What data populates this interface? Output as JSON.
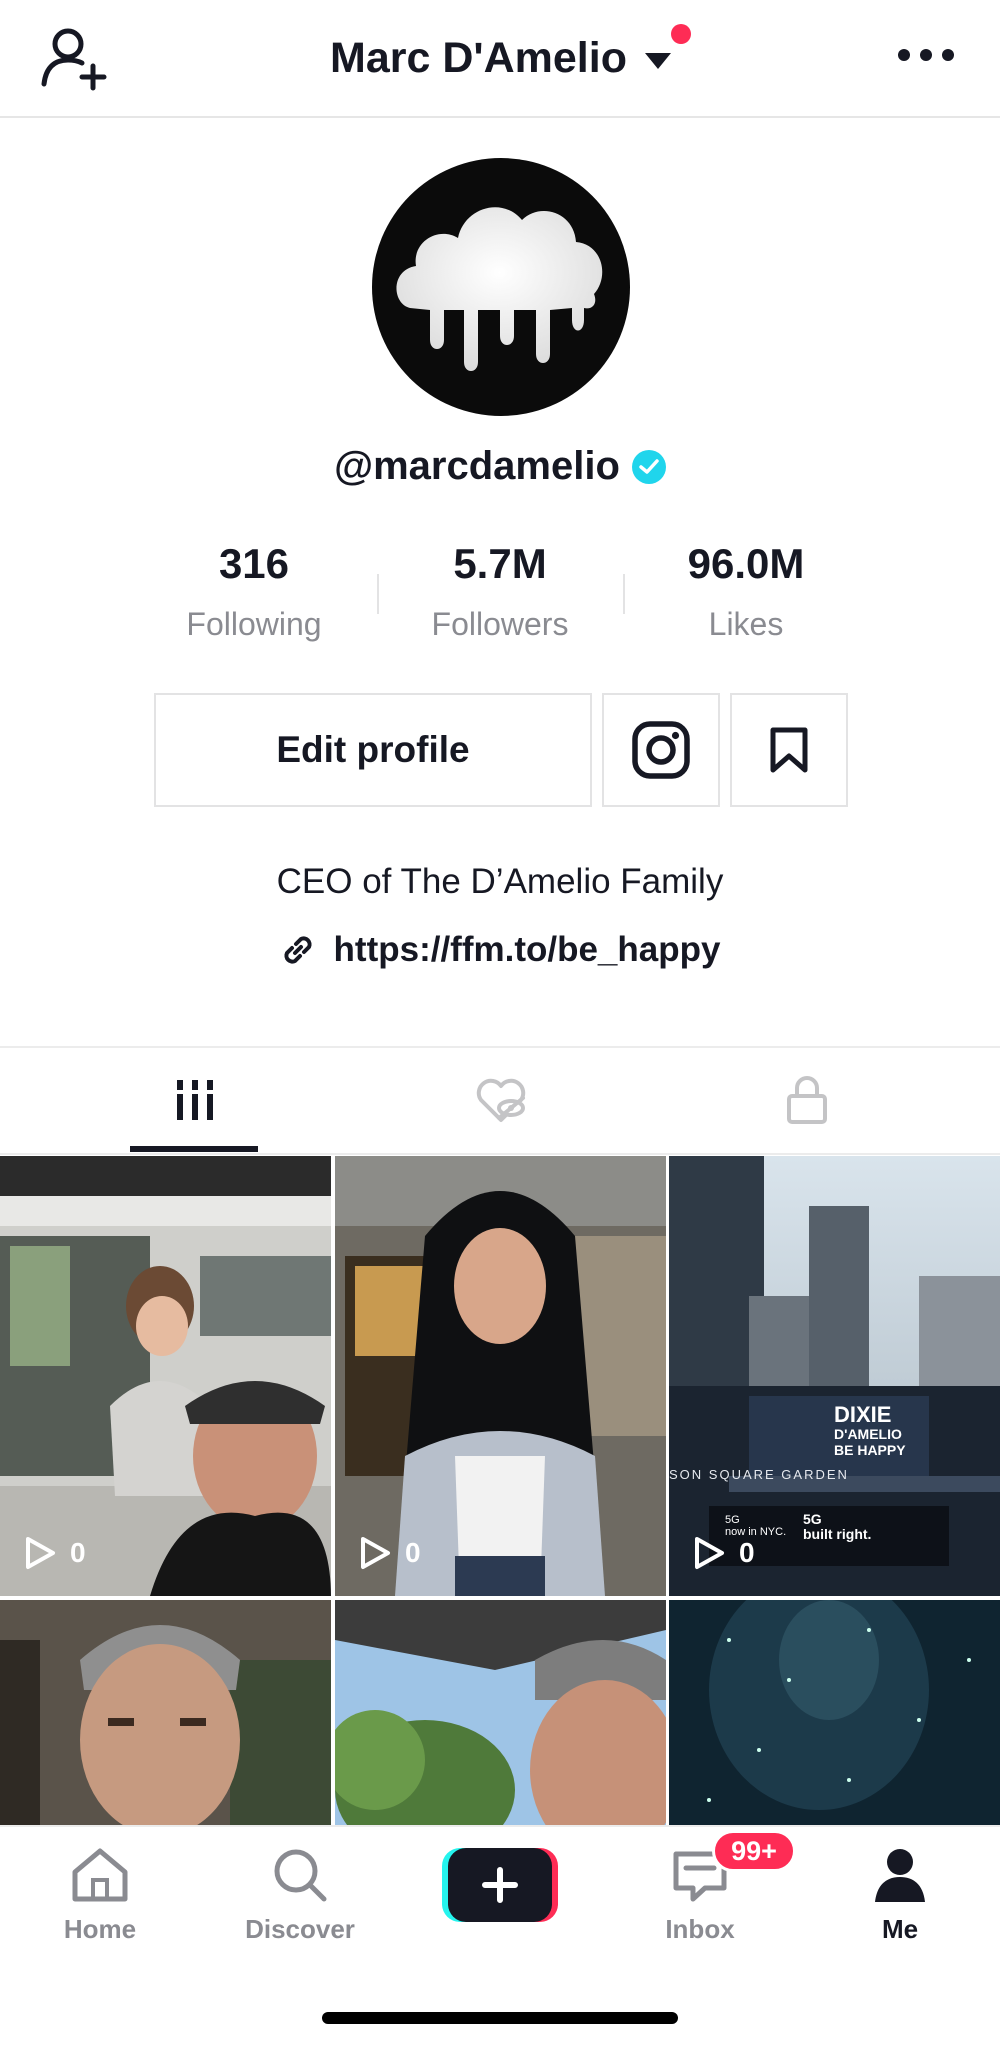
{
  "header": {
    "title": "Marc D'Amelio",
    "accent": "#fe2c55"
  },
  "profile": {
    "handle": "@marcdamelio",
    "verified": true,
    "stats": [
      {
        "value": "316",
        "label": "Following"
      },
      {
        "value": "5.7M",
        "label": "Followers"
      },
      {
        "value": "96.0M",
        "label": "Likes"
      }
    ],
    "edit_label": "Edit profile",
    "bio": "CEO of The D’Amelio Family",
    "link": "https://ffm.to/be_happy"
  },
  "tabs": [
    {
      "name": "videos",
      "icon": "grid-icon",
      "active": true
    },
    {
      "name": "liked",
      "icon": "hidden-heart-icon",
      "active": false
    },
    {
      "name": "private",
      "icon": "lock-icon",
      "active": false
    }
  ],
  "videos": [
    {
      "views": "0"
    },
    {
      "views": "0"
    },
    {
      "views": "0"
    },
    {
      "views": ""
    },
    {
      "views": ""
    },
    {
      "views": ""
    }
  ],
  "billboard": {
    "line1": "DIXIE",
    "line2": "D'AMELIO",
    "line3": "BE HAPPY",
    "venue": "SON SQUARE GARDEN",
    "ad1_a": "5G",
    "ad1_b": "now in NYC.",
    "ad2_a": "5G",
    "ad2_b": "built right."
  },
  "nav": {
    "items": [
      {
        "label": "Home",
        "icon": "home-icon"
      },
      {
        "label": "Discover",
        "icon": "search-icon"
      },
      {
        "label": "",
        "icon": "create-icon"
      },
      {
        "label": "Inbox",
        "icon": "inbox-icon"
      },
      {
        "label": "Me",
        "icon": "profile-icon"
      }
    ],
    "inbox_badge": "99+"
  }
}
